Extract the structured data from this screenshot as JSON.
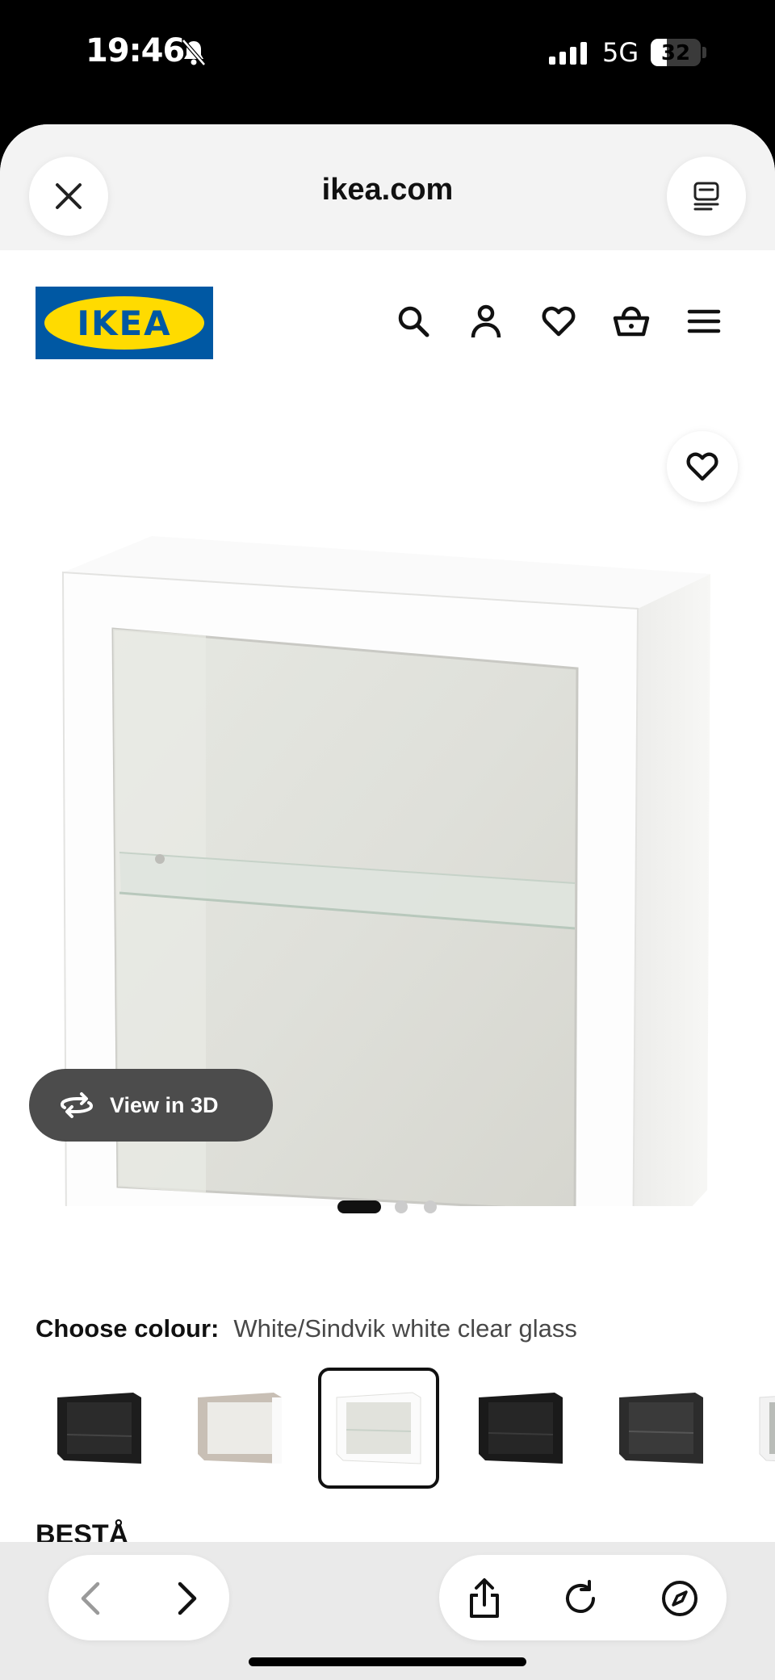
{
  "status_bar": {
    "time": "19:46",
    "network": "5G",
    "battery": "32",
    "battery_level_percent": 32
  },
  "browser": {
    "url": "ikea.com"
  },
  "site": {
    "logo_text": "IKEA",
    "brand_blue": "#0058a3",
    "brand_yellow": "#ffdb00"
  },
  "header_icons": [
    "search-icon",
    "account-icon",
    "heart-icon",
    "basket-icon",
    "menu-icon"
  ],
  "gallery": {
    "view_3d_label": "View in 3D",
    "image_count": 3,
    "active_index": 0
  },
  "colour": {
    "label": "Choose colour:",
    "value": "White/Sindvik white clear glass",
    "swatches": [
      "black",
      "beige/white",
      "white (selected)",
      "black-brown",
      "dark grey",
      "white/grey"
    ],
    "selected_index": 2
  },
  "product": {
    "series_name": "BESTÅ"
  },
  "toolbar_icons": [
    "back-icon",
    "forward-icon",
    "share-icon",
    "reload-icon",
    "compass-icon"
  ]
}
